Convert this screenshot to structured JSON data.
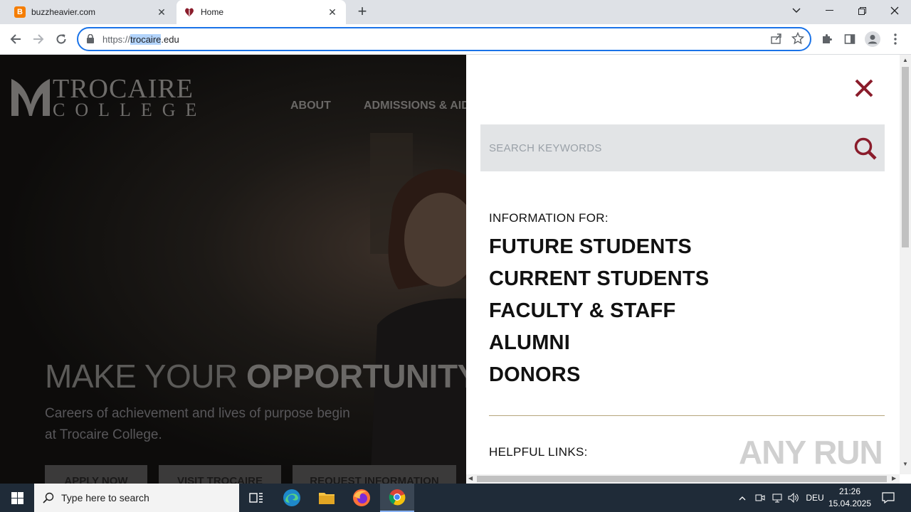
{
  "browser": {
    "tabs": [
      {
        "title": "buzzheavier.com",
        "favicon": "B"
      },
      {
        "title": "Home",
        "favicon": "trocaire-heart"
      }
    ],
    "address": {
      "scheme": "https://",
      "host_selected": "trocaire",
      "host_rest": ".edu"
    }
  },
  "site": {
    "logo_line1": "TROCAIRE",
    "logo_line2": "COLLEGE",
    "nav": [
      "ABOUT",
      "ADMISSIONS & AID"
    ],
    "headline_light": "MAKE YOUR ",
    "headline_bold": "OPPORTUNITY.",
    "subline": "Careers of achievement and lives of purpose begin at Trocaire College.",
    "ctas": [
      "APPLY NOW",
      "VISIT TROCAIRE",
      "REQUEST INFORMATION"
    ]
  },
  "panel": {
    "search_placeholder": "SEARCH KEYWORDS",
    "info_label": "INFORMATION FOR:",
    "audiences": [
      "FUTURE STUDENTS",
      "CURRENT STUDENTS",
      "FACULTY & STAFF",
      "ALUMNI",
      "DONORS"
    ],
    "helpful_label": "HELPFUL LINKS:",
    "accent_color": "#8a1c2b"
  },
  "watermark": "ANY RUN",
  "taskbar": {
    "search_placeholder": "Type here to search",
    "language": "DEU",
    "time": "21:26",
    "date": "15.04.2025"
  }
}
